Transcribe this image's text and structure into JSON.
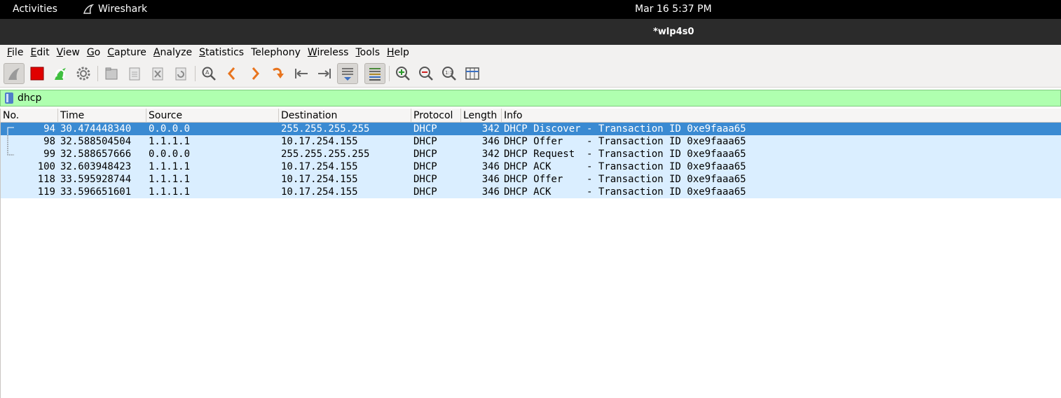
{
  "topbar": {
    "activities": "Activities",
    "app_name": "Wireshark",
    "clock": "Mar 16  5:37 PM"
  },
  "window": {
    "title": "*wlp4s0"
  },
  "menu": [
    {
      "label": "File",
      "key": "F",
      "rest": "ile"
    },
    {
      "label": "Edit",
      "key": "E",
      "rest": "dit"
    },
    {
      "label": "View",
      "key": "V",
      "rest": "iew"
    },
    {
      "label": "Go",
      "key": "G",
      "rest": "o"
    },
    {
      "label": "Capture",
      "key": "C",
      "rest": "apture"
    },
    {
      "label": "Analyze",
      "key": "A",
      "rest": "nalyze"
    },
    {
      "label": "Statistics",
      "key": "S",
      "rest": "tatistics"
    },
    {
      "label": "Telephony",
      "key": "",
      "rest": "Telephony"
    },
    {
      "label": "Wireless",
      "key": "W",
      "rest": "ireless"
    },
    {
      "label": "Tools",
      "key": "T",
      "rest": "ools"
    },
    {
      "label": "Help",
      "key": "H",
      "rest": "elp"
    }
  ],
  "filter": {
    "value": "dhcp"
  },
  "columns": {
    "no": "No.",
    "time": "Time",
    "source": "Source",
    "destination": "Destination",
    "protocol": "Protocol",
    "length": "Length",
    "info": "Info"
  },
  "packets": [
    {
      "no": "94",
      "time": "30.474448340",
      "source": "0.0.0.0",
      "destination": "255.255.255.255",
      "protocol": "DHCP",
      "length": "342",
      "info": "DHCP Discover - Transaction ID 0xe9faaa65"
    },
    {
      "no": "98",
      "time": "32.588504504",
      "source": "1.1.1.1",
      "destination": "10.17.254.155",
      "protocol": "DHCP",
      "length": "346",
      "info": "DHCP Offer    - Transaction ID 0xe9faaa65"
    },
    {
      "no": "99",
      "time": "32.588657666",
      "source": "0.0.0.0",
      "destination": "255.255.255.255",
      "protocol": "DHCP",
      "length": "342",
      "info": "DHCP Request  - Transaction ID 0xe9faaa65"
    },
    {
      "no": "100",
      "time": "32.603948423",
      "source": "1.1.1.1",
      "destination": "10.17.254.155",
      "protocol": "DHCP",
      "length": "346",
      "info": "DHCP ACK      - Transaction ID 0xe9faaa65"
    },
    {
      "no": "118",
      "time": "33.595928744",
      "source": "1.1.1.1",
      "destination": "10.17.254.155",
      "protocol": "DHCP",
      "length": "346",
      "info": "DHCP Offer    - Transaction ID 0xe9faaa65"
    },
    {
      "no": "119",
      "time": "33.596651601",
      "source": "1.1.1.1",
      "destination": "10.17.254.155",
      "protocol": "DHCP",
      "length": "346",
      "info": "DHCP ACK      - Transaction ID 0xe9faaa65"
    }
  ],
  "colors": {
    "selected_row": "#3a8ad2",
    "row_udp": "#daeeff",
    "filter_valid": "#afffaf",
    "stop_red": "#e00000"
  }
}
